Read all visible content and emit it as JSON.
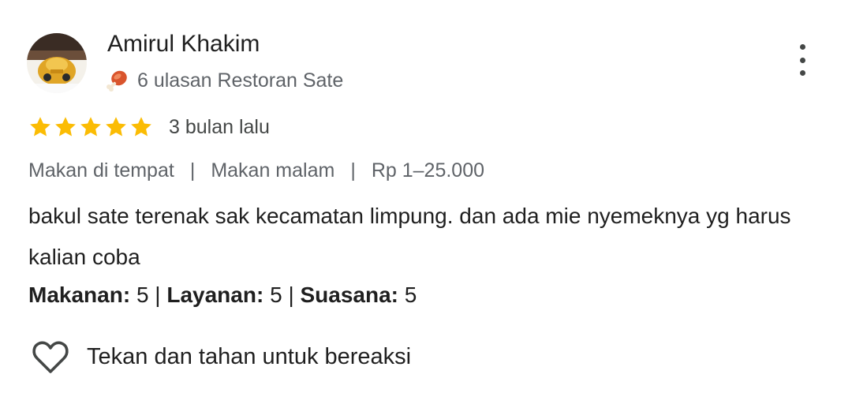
{
  "reviewer": {
    "name": "Amirul Khakim",
    "badge_icon": "drumstick-icon",
    "meta": "6 ulasan Restoran Sate"
  },
  "review": {
    "stars": 5,
    "max_stars": 5,
    "star_color": "#fbbc04",
    "time": "3 bulan lalu",
    "tags": [
      "Makan di tempat",
      "Makan malam",
      "Rp 1–25.000"
    ],
    "separator": "|",
    "text": "bakul sate terenak sak kecamatan limpung. dan ada mie nyemeknya yg harus kalian coba",
    "ratings": [
      {
        "label": "Makanan",
        "value": "5"
      },
      {
        "label": "Layanan",
        "value": "5"
      },
      {
        "label": "Suasana",
        "value": "5"
      }
    ]
  },
  "actions": {
    "react_label": "Tekan dan tahan untuk bereaksi",
    "react_icon": "heart-outline-icon",
    "more_icon": "more-vertical-icon"
  }
}
